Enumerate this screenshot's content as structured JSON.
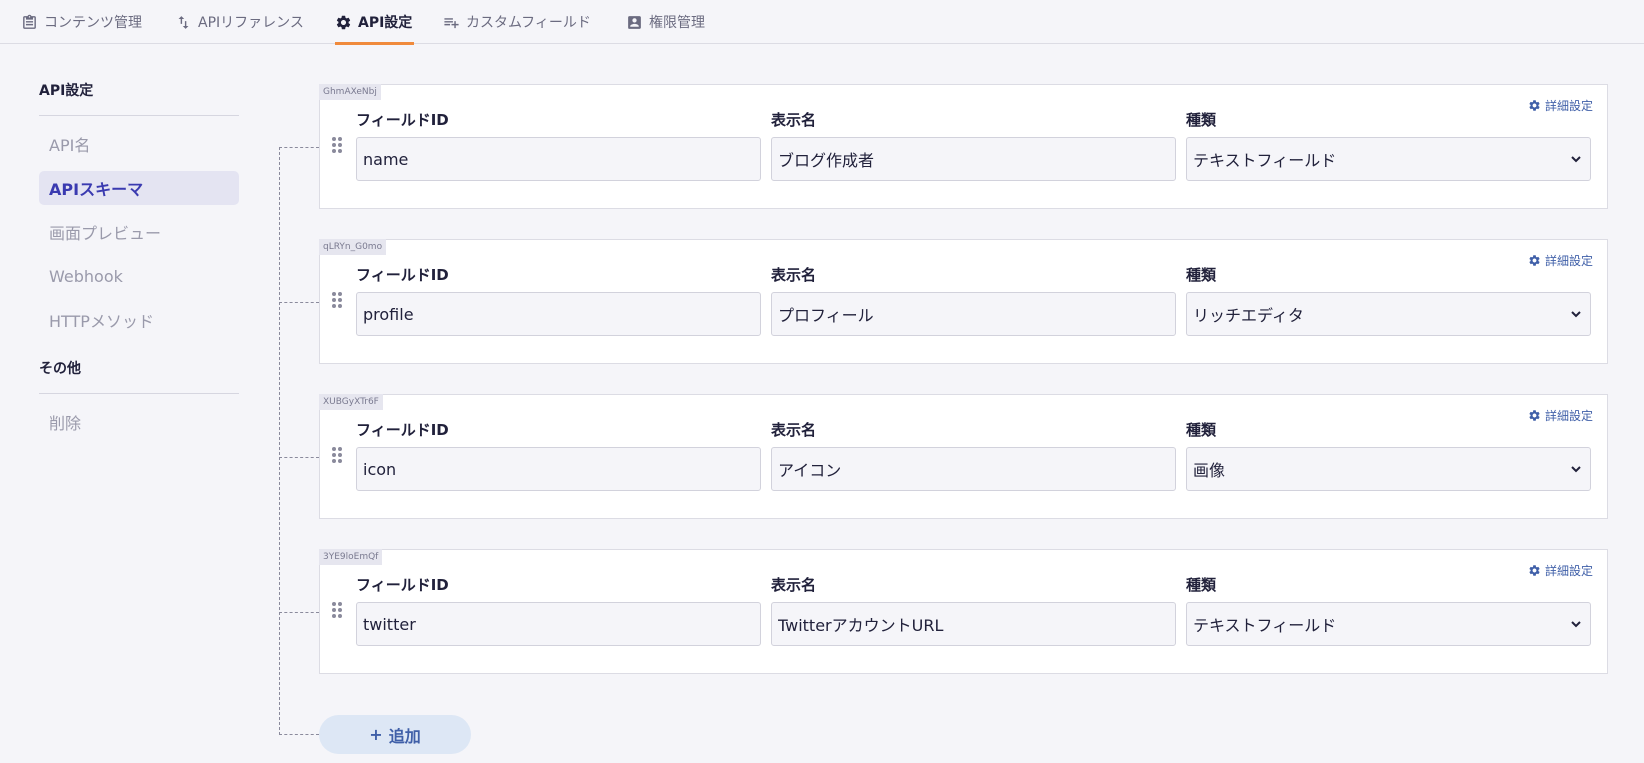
{
  "tabs": [
    {
      "label": "コンテンツ管理",
      "icon": "clipboard-icon",
      "active": false
    },
    {
      "label": "APIリファレンス",
      "icon": "swap-vert-icon",
      "active": false
    },
    {
      "label": "API設定",
      "icon": "gear-icon",
      "active": true
    },
    {
      "label": "カスタムフィールド",
      "icon": "playlist-add-icon",
      "active": false
    },
    {
      "label": "権限管理",
      "icon": "account-box-icon",
      "active": false
    }
  ],
  "sidebar": {
    "api_heading": "API設定",
    "api_items": [
      {
        "label": "API名"
      },
      {
        "label": "APIスキーマ"
      },
      {
        "label": "画面プレビュー"
      },
      {
        "label": "Webhook"
      },
      {
        "label": "HTTPメソッド"
      }
    ],
    "other_heading": "その他",
    "other_items": [
      {
        "label": "削除"
      }
    ]
  },
  "labels": {
    "field_id": "フィールドID",
    "display_name": "表示名",
    "type": "種類",
    "detail_settings": "詳細設定"
  },
  "fields": [
    {
      "uid": "GhmAXeNbj",
      "field_id": "name",
      "display_name": "ブログ作成者",
      "type": "テキストフィールド"
    },
    {
      "uid": "qLRYn_G0mo",
      "field_id": "profile",
      "display_name": "プロフィール",
      "type": "リッチエディタ"
    },
    {
      "uid": "XUBGyXTr6F",
      "field_id": "icon",
      "display_name": "アイコン",
      "type": "画像"
    },
    {
      "uid": "3YE9loEmQf",
      "field_id": "twitter",
      "display_name": "TwitterアカウントURL",
      "type": "テキストフィールド"
    }
  ],
  "add_button": {
    "label": "追加",
    "icon": "plus-icon"
  },
  "colors": {
    "accent_tab": "#f08a3c",
    "active_sidebar_text": "#3a3ab0",
    "link_blue": "#3f5fa8"
  }
}
